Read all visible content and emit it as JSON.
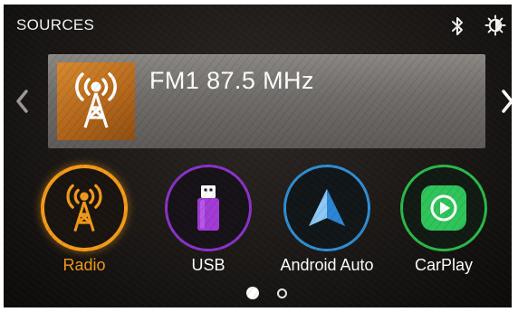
{
  "header": {
    "title": "SOURCES",
    "icons": [
      "bluetooth-icon",
      "brightness-icon"
    ]
  },
  "now_playing": {
    "station": "FM1 87.5 MHz",
    "thumbnail_icon": "radio-tower-icon"
  },
  "sources": [
    {
      "label": "Radio",
      "icon": "radio-tower-icon",
      "active": true,
      "ring_color": "#f29a18"
    },
    {
      "label": "USB",
      "icon": "usb-drive-icon",
      "active": false,
      "ring_color": "#8a33c8"
    },
    {
      "label": "Android Auto",
      "icon": "android-auto-icon",
      "active": false,
      "ring_color": "#2f8ed2"
    },
    {
      "label": "CarPlay",
      "icon": "carplay-icon",
      "active": false,
      "ring_color": "#2bb84a"
    }
  ],
  "pagination": {
    "total": 2,
    "current": 1
  },
  "colors": {
    "accent": "#f29a18",
    "panel": "#77736f",
    "background": "#1b1816"
  }
}
